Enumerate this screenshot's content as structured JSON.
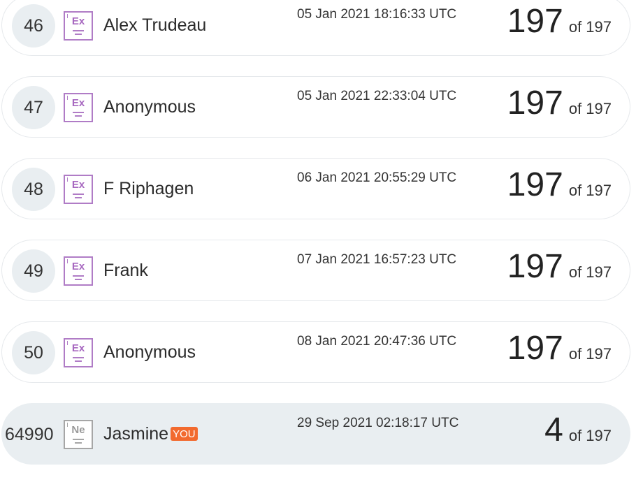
{
  "leaderboard": {
    "rows": [
      {
        "rank": "46",
        "level": "Ex",
        "name": "Alex Trudeau",
        "timestamp": "05 Jan 2021 18:16:33 UTC",
        "score": "197",
        "of": "of 197"
      },
      {
        "rank": "47",
        "level": "Ex",
        "name": "Anonymous",
        "timestamp": "05 Jan 2021 22:33:04 UTC",
        "score": "197",
        "of": "of 197"
      },
      {
        "rank": "48",
        "level": "Ex",
        "name": "F Riphagen",
        "timestamp": "06 Jan 2021 20:55:29 UTC",
        "score": "197",
        "of": "of 197"
      },
      {
        "rank": "49",
        "level": "Ex",
        "name": "Frank",
        "timestamp": "07 Jan 2021 16:57:23 UTC",
        "score": "197",
        "of": "of 197"
      },
      {
        "rank": "50",
        "level": "Ex",
        "name": "Anonymous",
        "timestamp": "08 Jan 2021 20:47:36 UTC",
        "score": "197",
        "of": "of 197"
      }
    ],
    "current_user": {
      "rank": "64990",
      "level": "Ne",
      "name": "Jasmine",
      "badge": "YOU",
      "timestamp": "29 Sep 2021 02:18:17 UTC",
      "score": "4",
      "of": "of 197"
    }
  },
  "colors": {
    "expert_level": "#b07cc6",
    "novice_level": "#a6a6a6",
    "you_badge": "#f26a2e",
    "current_user_row": "#e9eef1"
  }
}
